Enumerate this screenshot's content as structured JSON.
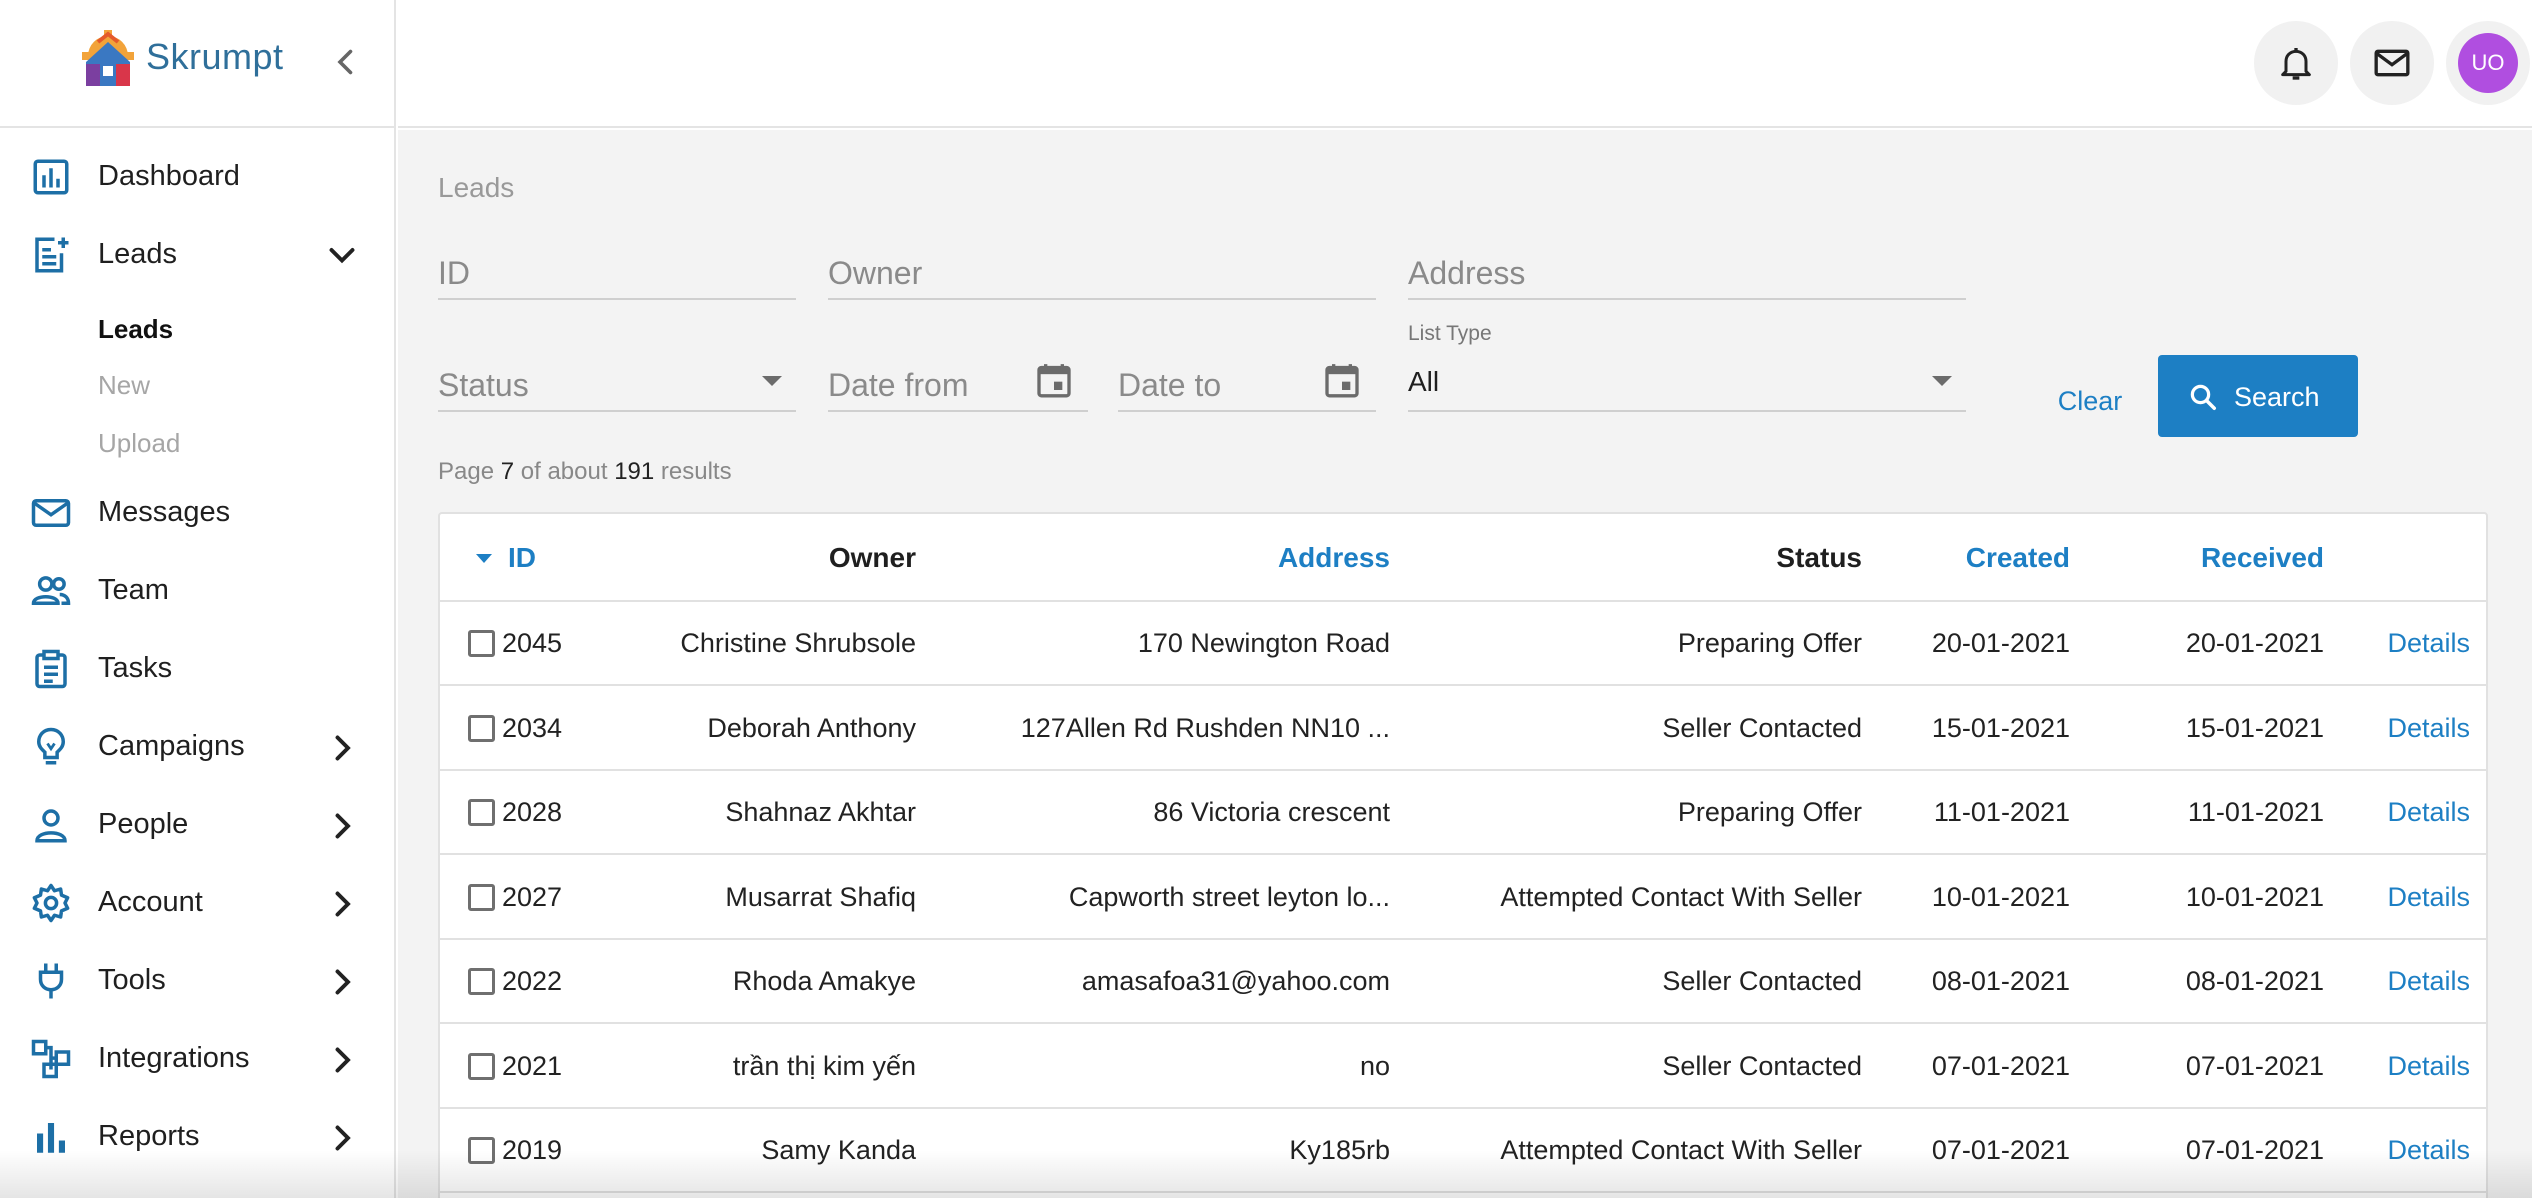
{
  "brand": {
    "name": "Skrumpt"
  },
  "topbar": {
    "notifications_icon": "bell-icon",
    "messages_icon": "mail-icon",
    "avatar_initials": "UO",
    "avatar_color": "#b04ee0"
  },
  "sidebar": {
    "items": [
      {
        "label": "Dashboard",
        "icon": "dashboard-icon"
      },
      {
        "label": "Leads",
        "icon": "leads-icon",
        "expanded": true,
        "children": [
          {
            "label": "Leads",
            "active": true
          },
          {
            "label": "New",
            "active": false
          },
          {
            "label": "Upload",
            "active": false
          }
        ]
      },
      {
        "label": "Messages",
        "icon": "mail-icon"
      },
      {
        "label": "Team",
        "icon": "team-icon"
      },
      {
        "label": "Tasks",
        "icon": "clipboard-icon"
      },
      {
        "label": "Campaigns",
        "icon": "lightbulb-icon"
      },
      {
        "label": "People",
        "icon": "person-icon"
      },
      {
        "label": "Account",
        "icon": "gear-icon"
      },
      {
        "label": "Tools",
        "icon": "plug-icon"
      },
      {
        "label": "Integrations",
        "icon": "integrations-icon"
      },
      {
        "label": "Reports",
        "icon": "bar-chart-icon"
      }
    ]
  },
  "main": {
    "breadcrumb": "Leads",
    "filters": {
      "id_placeholder": "ID",
      "owner_placeholder": "Owner",
      "address_placeholder": "Address",
      "status_placeholder": "Status",
      "date_from_placeholder": "Date from",
      "date_to_placeholder": "Date to",
      "list_type_label": "List Type",
      "list_type_value": "All"
    },
    "clear_label": "Clear",
    "search_label": "Search",
    "results": {
      "prefix": "Page",
      "page": "7",
      "middle": "of about",
      "total": "191",
      "suffix": "results"
    },
    "table": {
      "columns": [
        "ID",
        "Owner",
        "Address",
        "Status",
        "Created",
        "Received"
      ],
      "details_label": "Details",
      "rows": [
        {
          "id": "2045",
          "owner": "Christine Shrubsole",
          "address": "170 Newington Road",
          "status": "Preparing Offer",
          "created": "20-01-2021",
          "received": "20-01-2021"
        },
        {
          "id": "2034",
          "owner": "Deborah Anthony",
          "address": "127Allen Rd Rushden NN10 ...",
          "status": "Seller Contacted",
          "created": "15-01-2021",
          "received": "15-01-2021"
        },
        {
          "id": "2028",
          "owner": "Shahnaz Akhtar",
          "address": "86 Victoria crescent",
          "status": "Preparing Offer",
          "created": "11-01-2021",
          "received": "11-01-2021"
        },
        {
          "id": "2027",
          "owner": "Musarrat Shafiq",
          "address": "Capworth street leyton lo...",
          "status": "Attempted Contact With Seller",
          "created": "10-01-2021",
          "received": "10-01-2021"
        },
        {
          "id": "2022",
          "owner": "Rhoda Amakye",
          "address": "amasafoa31@yahoo.com",
          "status": "Seller Contacted",
          "created": "08-01-2021",
          "received": "08-01-2021"
        },
        {
          "id": "2021",
          "owner": "trần thị kim yến",
          "address": "no",
          "status": "Seller Contacted",
          "created": "07-01-2021",
          "received": "07-01-2021"
        },
        {
          "id": "2019",
          "owner": "Samy Kanda",
          "address": "Ky185rb",
          "status": "Attempted Contact With Seller",
          "created": "07-01-2021",
          "received": "07-01-2021"
        }
      ]
    }
  },
  "colors": {
    "accent": "#1d7fc4",
    "icon": "#1d6fa6"
  }
}
